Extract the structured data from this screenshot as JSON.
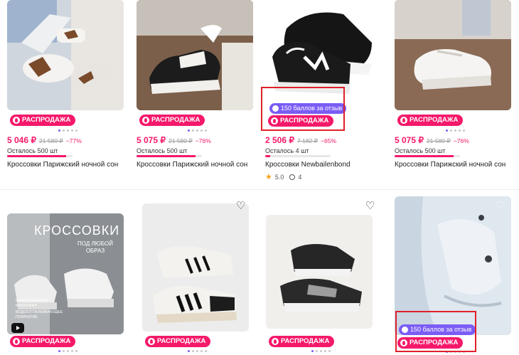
{
  "products": [
    {
      "badge": "РАСПРОДАЖА",
      "price": "5 046 ₽",
      "old_price": "21 580 ₽",
      "discount": "−77%",
      "stock": "Осталось 500 шт",
      "stock_level": 0.9,
      "title": "Кроссовки Парижский ночной сон"
    },
    {
      "badge": "РАСПРОДАЖА",
      "price": "5 075 ₽",
      "old_price": "21 580 ₽",
      "discount": "−76%",
      "stock": "Осталось 500 шт",
      "stock_level": 0.9,
      "title": "Кроссовки Парижский ночной сон"
    },
    {
      "points": "150 баллов за отзыв",
      "badge": "РАСПРОДАЖА",
      "price": "2 506 ₽",
      "old_price": "7 182 ₽",
      "discount": "−65%",
      "stock": "Осталось 4 шт",
      "stock_level": 0.08,
      "title": "Кроссовки Newbailenbond",
      "rating": "5.0",
      "reviews": "4"
    },
    {
      "badge": "РАСПРОДАЖА",
      "price": "5 075 ₽",
      "old_price": "21 580 ₽",
      "discount": "−76%",
      "stock": "Осталось 500 шт",
      "stock_level": 0.9,
      "title": "Кроссовки Парижский ночной сон"
    },
    {
      "badge": "РАСПРОДАЖА",
      "promo_title": "КРОССОВКИ",
      "promo_sub": "ПОД ЛЮБОЙ ОБРАЗ",
      "promo_f1": "КАЧЕСТВЕННЫЙ МАТЕРИАЛ",
      "promo_f2": "ВОДООТТАЛКИВАЮЩЕЕ ПОКРЫТИЕ"
    },
    {
      "badge": "РАСПРОДАЖА"
    },
    {
      "badge": "РАСПРОДАЖА"
    },
    {
      "points": "150 баллов за отзыв",
      "badge": "РАСПРОДАЖА"
    }
  ],
  "colors": {
    "accent": "#f5196a",
    "points": "#7b5cf5",
    "highlight": "#e0202a"
  },
  "icons": {
    "favorite": "heart-icon",
    "sale": "fire-icon",
    "points": "coin-icon",
    "video": "play-icon",
    "rating": "star-icon",
    "reviews": "comment-icon"
  }
}
